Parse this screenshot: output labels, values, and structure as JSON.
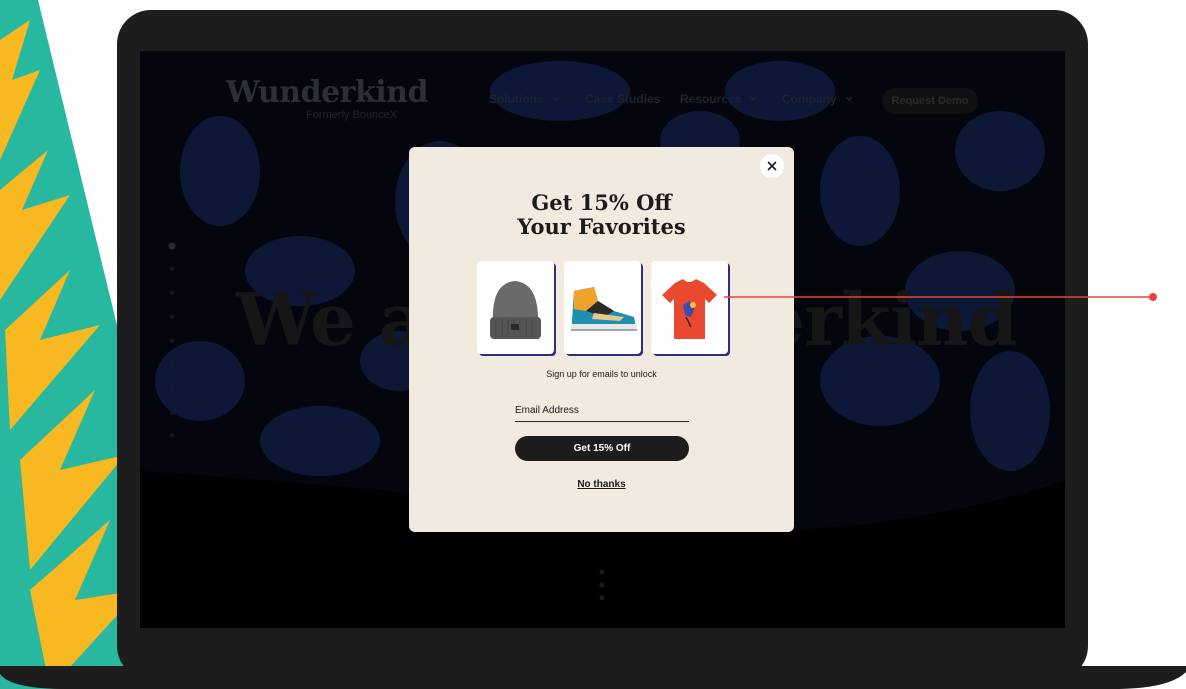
{
  "site": {
    "logo": "Wunderkind",
    "logo_subtitle": "Formerly BounceX",
    "nav": [
      {
        "label": "Solutions",
        "has_dropdown": true
      },
      {
        "label": "Case Studies",
        "has_dropdown": false
      },
      {
        "label": "Resources",
        "has_dropdown": true
      },
      {
        "label": "Company",
        "has_dropdown": true
      }
    ],
    "cta_label": "Request Demo",
    "hero_text": "We are Wunderkind"
  },
  "modal": {
    "close_icon": "close-icon",
    "title_line1": "Get 15% Off",
    "title_line2": "Your Favorites",
    "products": [
      {
        "name": "beanie",
        "icon": "beanie-image"
      },
      {
        "name": "sneaker",
        "icon": "sneaker-image"
      },
      {
        "name": "t-shirt",
        "icon": "tshirt-image"
      }
    ],
    "subtitle": "Sign up for emails to unlock",
    "email_placeholder": "Email Address",
    "submit_label": "Get 15% Off",
    "decline_label": "No thanks"
  },
  "colors": {
    "modal_bg": "#f2e9df",
    "button_bg": "#1d1d1d",
    "callout": "#e8433a",
    "teal": "#27b89f",
    "lightning": "#f7b821"
  }
}
